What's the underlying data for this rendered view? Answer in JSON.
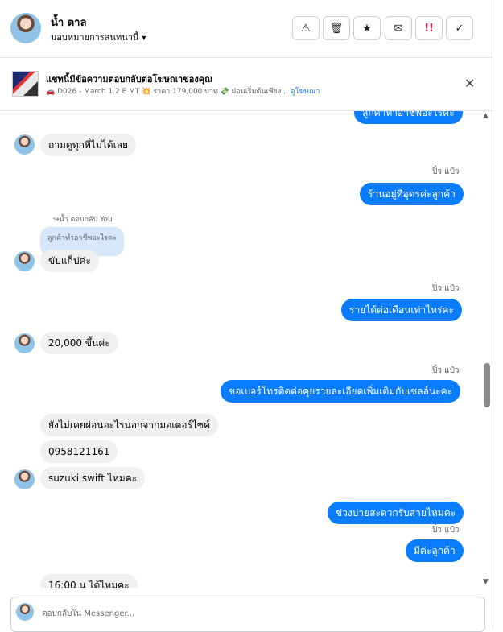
{
  "header": {
    "name": "น้ำ ตาล",
    "assign_label": "มอบหมายการสนทนานี้",
    "caret": "▾",
    "buttons": [
      {
        "name": "report-button",
        "glyph": "⚠"
      },
      {
        "name": "delete-button",
        "glyph": "🗑"
      },
      {
        "name": "star-button",
        "glyph": "★"
      },
      {
        "name": "mark-unread-button",
        "glyph": "✉"
      },
      {
        "name": "priority-button",
        "glyph": "!!"
      },
      {
        "name": "done-button",
        "glyph": "✓"
      }
    ]
  },
  "ad": {
    "title": "แชทนี้มีข้อความตอบกลับต่อโฆษณาของคุณ",
    "line": "🚗 D026 - March 1.2 E MT 💥 ราคา 179,000 บาท 💸 ผ่อนเริ่มต้นเพียง...",
    "link": "ดูโฆษณา",
    "close": "✕"
  },
  "messages": {
    "m1": "ลูกค้าทำอาชีพอะไรคะ",
    "m2": "ถามดูทุกที่ไม่ได้เลย",
    "sender1": "ปิ๋ว แป๋ว",
    "m3": "ร้านอยู่ที่อุดรค่ะลูกค้า",
    "reply_meta": "↪น้ำ ตอบกลับ You",
    "quoted": "ลูกค้าทำอาชีพอะไรคะ",
    "m4": "ขับแก็ปค่ะ",
    "sender2": "ปิ๋ว แป๋ว",
    "m5": "รายได้ต่อเดือนเท่าไหร่คะ",
    "m6": "20,000 ขึ้นค่ะ",
    "sender3": "ปิ๋ว แป๋ว",
    "m7": "ขอเบอร์โทรติดต่อคุยรายละเอียดเพิ่มเติมกับเซลล์นะคะ",
    "m8": "ยังไม่เคยผ่อนอะไรนอกจากมอเตอร์ไซค์",
    "m9": "0958121161",
    "m10": "suzuki swift ไหมคะ",
    "m11": "ช่วงบ่ายสะดวกรับสายไหมคะ",
    "sender4": "ปิ๋ว แป๋ว",
    "m12": "มีค่ะลูกค้า",
    "m13": "16:00 น ได้ไหมคะ"
  },
  "composer": {
    "placeholder": "ตอบกลับใน Messenger..."
  },
  "scrollbar": {
    "up": "▲",
    "down": "▼"
  }
}
